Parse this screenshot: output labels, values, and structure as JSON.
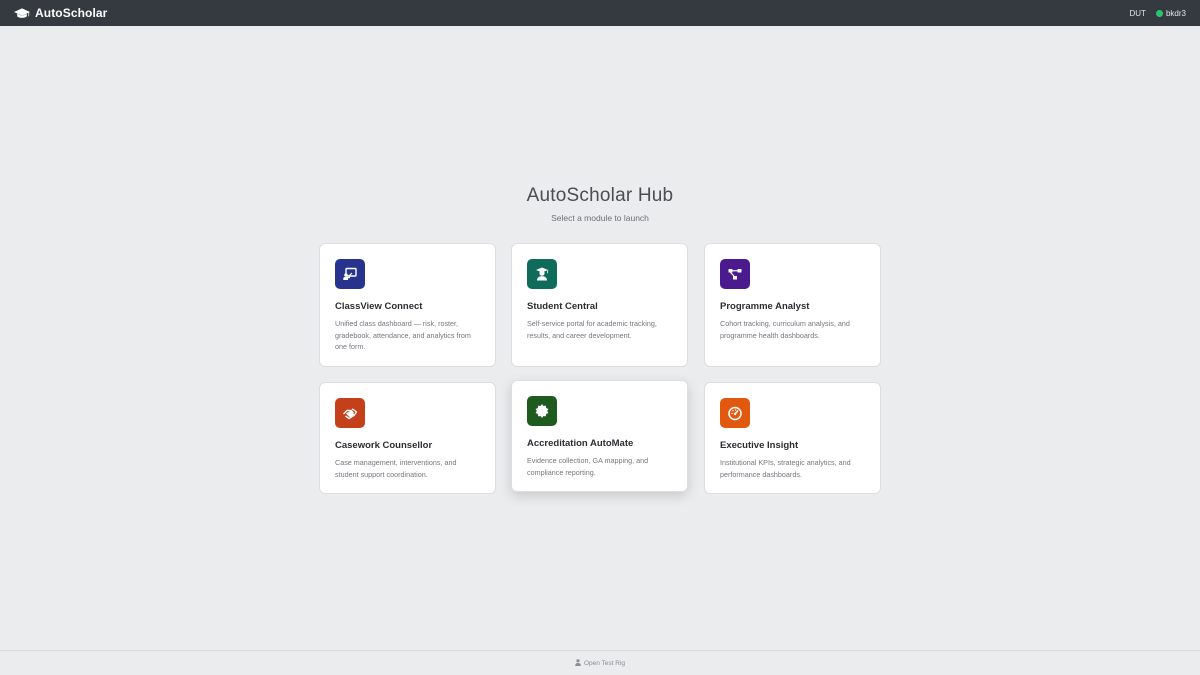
{
  "header": {
    "brand": "AutoScholar",
    "brand_icon": "graduation-cap-icon",
    "institution": "DUT",
    "username": "bkdr3",
    "status_color": "#28c76f"
  },
  "hero": {
    "title": "AutoScholar Hub",
    "subtitle": "Select a module to launch"
  },
  "modules": [
    {
      "title": "ClassView Connect",
      "description": "Unified class dashboard — risk, roster, gradebook, attendance, and analytics from one form.",
      "icon": "chalkboard-teacher-icon",
      "color": "#27338c"
    },
    {
      "title": "Student Central",
      "description": "Self-service portal for academic tracking, results, and career development.",
      "icon": "user-graduate-icon",
      "color": "#0f6b5a"
    },
    {
      "title": "Programme Analyst",
      "description": "Cohort tracking, curriculum analysis, and programme health dashboards.",
      "icon": "project-diagram-icon",
      "color": "#4b1a8e"
    },
    {
      "title": "Casework Counsellor",
      "description": "Case management, interventions, and student support coordination.",
      "icon": "hands-helping-icon",
      "color": "#c3401a"
    },
    {
      "title": "Accreditation AutoMate",
      "description": "Evidence collection, GA mapping, and compliance reporting.",
      "icon": "certificate-icon",
      "color": "#1f5a1f"
    },
    {
      "title": "Executive Insight",
      "description": "Institutional KPIs, strategic analytics, and performance dashboards.",
      "icon": "tachometer-icon",
      "color": "#e0590f"
    }
  ],
  "footer": {
    "link_label": "Open Test Rig",
    "icon": "user-icon"
  }
}
